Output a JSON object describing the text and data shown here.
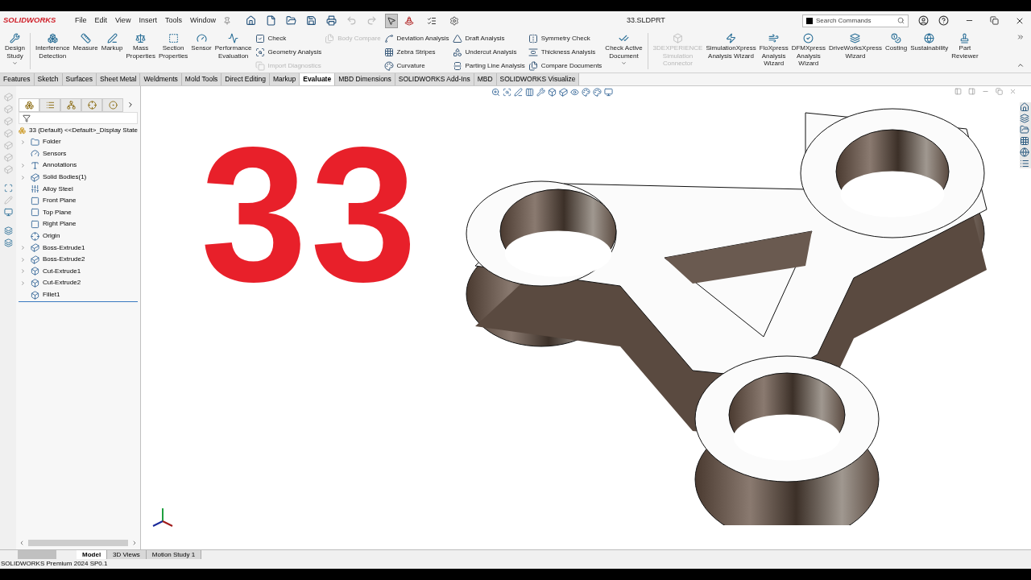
{
  "app": {
    "logo": "SOLIDWORKS",
    "menus": [
      "File",
      "Edit",
      "View",
      "Insert",
      "Tools",
      "Window"
    ],
    "document_title": "33.SLDPRT",
    "search": {
      "placeholder": "Search Commands"
    },
    "select_tool": {
      "pressed": true
    }
  },
  "ribbon": [
    {
      "kind": "large",
      "label": "Design\nStudy",
      "disabled": false,
      "dropdown": true
    },
    {
      "kind": "divider"
    },
    {
      "kind": "large",
      "label": "Interference\nDetection",
      "disabled": false,
      "dropdown": false
    },
    {
      "kind": "large",
      "label": "Measure",
      "disabled": false,
      "dropdown": false
    },
    {
      "kind": "large",
      "label": "Markup",
      "disabled": false,
      "dropdown": false
    },
    {
      "kind": "large",
      "label": "Mass\nProperties",
      "disabled": false,
      "dropdown": false
    },
    {
      "kind": "large",
      "label": "Section\nProperties",
      "disabled": false,
      "dropdown": false
    },
    {
      "kind": "large",
      "label": "Sensor",
      "disabled": false,
      "dropdown": false
    },
    {
      "kind": "large",
      "label": "Performance\nEvaluation",
      "disabled": false,
      "dropdown": false
    },
    {
      "kind": "column",
      "items": [
        {
          "label": "Check",
          "disabled": false
        },
        {
          "label": "Geometry Analysis",
          "disabled": false
        },
        {
          "label": "Import Diagnostics",
          "disabled": true
        }
      ]
    },
    {
      "kind": "column",
      "items": [
        {
          "label": "Body Compare",
          "disabled": true
        }
      ]
    },
    {
      "kind": "column",
      "items": [
        {
          "label": "Deviation Analysis",
          "disabled": false
        },
        {
          "label": "Zebra Stripes",
          "disabled": false
        },
        {
          "label": "Curvature",
          "disabled": false
        }
      ]
    },
    {
      "kind": "column",
      "items": [
        {
          "label": "Draft Analysis",
          "disabled": false
        },
        {
          "label": "Undercut Analysis",
          "disabled": false
        },
        {
          "label": "Parting Line Analysis",
          "disabled": false
        }
      ]
    },
    {
      "kind": "column",
      "items": [
        {
          "label": "Symmetry Check",
          "disabled": false
        },
        {
          "label": "Thickness Analysis",
          "disabled": false
        },
        {
          "label": "Compare Documents",
          "disabled": false
        }
      ]
    },
    {
      "kind": "large",
      "label": "Check Active\nDocument",
      "disabled": false,
      "dropdown": true
    },
    {
      "kind": "divider"
    },
    {
      "kind": "large",
      "label": "3DEXPERIENCE\nSimulation\nConnector",
      "disabled": true,
      "dropdown": false
    },
    {
      "kind": "large",
      "label": "SimulationXpress\nAnalysis Wizard",
      "disabled": false,
      "dropdown": false
    },
    {
      "kind": "large",
      "label": "FloXpress\nAnalysis\nWizard",
      "disabled": false,
      "dropdown": false
    },
    {
      "kind": "large",
      "label": "DFMXpress\nAnalysis\nWizard",
      "disabled": false,
      "dropdown": false
    },
    {
      "kind": "large",
      "label": "DriveWorksXpress\nWizard",
      "disabled": false,
      "dropdown": false
    },
    {
      "kind": "large",
      "label": "Costing",
      "disabled": false,
      "dropdown": false
    },
    {
      "kind": "large",
      "label": "Sustainability",
      "disabled": false,
      "dropdown": false
    },
    {
      "kind": "large",
      "label": "Part\nReviewer",
      "disabled": false,
      "dropdown": false
    }
  ],
  "command_tabs": [
    {
      "label": "Features",
      "selected": false
    },
    {
      "label": "Sketch",
      "selected": false
    },
    {
      "label": "Surfaces",
      "selected": false
    },
    {
      "label": "Sheet Metal",
      "selected": false
    },
    {
      "label": "Weldments",
      "selected": false
    },
    {
      "label": "Mold Tools",
      "selected": false
    },
    {
      "label": "Direct Editing",
      "selected": false
    },
    {
      "label": "Markup",
      "selected": false
    },
    {
      "label": "Evaluate",
      "selected": true
    },
    {
      "label": "MBD Dimensions",
      "selected": false
    },
    {
      "label": "SOLIDWORKS Add-Ins",
      "selected": false
    },
    {
      "label": "MBD",
      "selected": false
    },
    {
      "label": "SOLIDWORKS Visualize",
      "selected": false
    }
  ],
  "panel_tabs": [
    {
      "selected": true
    },
    {
      "selected": false
    },
    {
      "selected": false
    },
    {
      "selected": false
    },
    {
      "selected": false
    }
  ],
  "feature_tree": {
    "root": "33 (Default) <<Default>_Display State",
    "items": [
      {
        "label": "Folder",
        "expandable": true
      },
      {
        "label": "Sensors",
        "expandable": false
      },
      {
        "label": "Annotations",
        "expandable": true
      },
      {
        "label": "Solid Bodies(1)",
        "expandable": true
      },
      {
        "label": "Alloy Steel",
        "expandable": false
      },
      {
        "label": "Front Plane",
        "expandable": false
      },
      {
        "label": "Top Plane",
        "expandable": false
      },
      {
        "label": "Right Plane",
        "expandable": false
      },
      {
        "label": "Origin",
        "expandable": false
      },
      {
        "label": "Boss-Extrude1",
        "expandable": true
      },
      {
        "label": "Boss-Extrude2",
        "expandable": true
      },
      {
        "label": "Cut-Extrude1",
        "expandable": true
      },
      {
        "label": "Cut-Extrude2",
        "expandable": true
      },
      {
        "label": "Fillet1",
        "expandable": false
      }
    ]
  },
  "viewport": {
    "overlay_text": "33"
  },
  "bottom_tabs": [
    {
      "label": "Model",
      "selected": true
    },
    {
      "label": "3D Views",
      "selected": false
    },
    {
      "label": "Motion Study 1",
      "selected": false
    }
  ],
  "status_bar": {
    "text": "SOLIDWORKS Premium 2024 SP0.1"
  }
}
